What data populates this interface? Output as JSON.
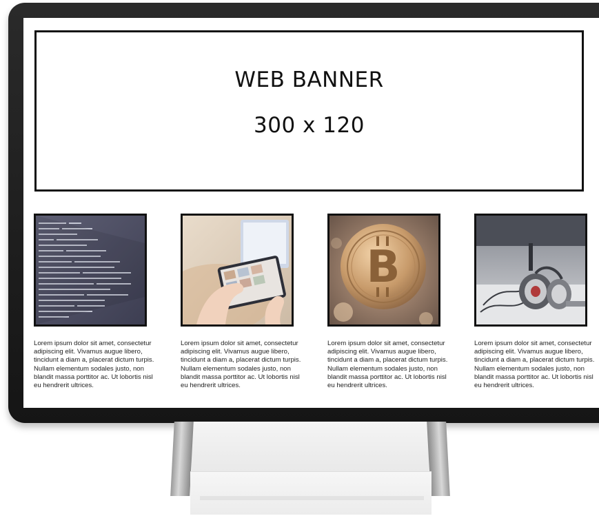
{
  "banner": {
    "line1": "WEB BANNER",
    "line2": "300 x 120"
  },
  "cards": [
    {
      "image_icon": "code-screen-photo",
      "text": "Lorem ipsum dolor sit amet, consectetur adipiscing elit. Vivamus augue libero, tincidunt a diam a, placerat dictum turpis. Nullam elementum sodales justo, non blandit massa porttitor ac. Ut lobortis nisl eu hendrerit ultrices."
    },
    {
      "image_icon": "tablet-hands-photo",
      "text": "Lorem ipsum dolor sit amet, consectetur adipiscing elit. Vivamus augue libero, tincidunt a diam a, placerat dictum turpis. Nullam elementum sodales justo, non blandit massa porttitor ac. Ut lobortis nisl eu hendrerit ultrices."
    },
    {
      "image_icon": "bitcoin-coin-photo",
      "text": "Lorem ipsum dolor sit amet, consectetur adipiscing elit. Vivamus augue libero, tincidunt a diam a, placerat dictum turpis. Nullam elementum sodales justo, non blandit massa porttitor ac. Ut lobortis nisl eu hendrerit ultrices."
    },
    {
      "image_icon": "headphones-photo",
      "text": "Lorem ipsum dolor sit amet, consectetur adipiscing elit. Vivamus augue libero, tincidunt a diam a, placerat dictum turpis. Nullam elementum sodales justo, non blandit massa porttitor ac. Ut lobortis nisl eu hendrerit ultrices."
    }
  ],
  "colors": {
    "bezel": "#1a1a1a",
    "border": "#111111",
    "text": "#222222"
  }
}
